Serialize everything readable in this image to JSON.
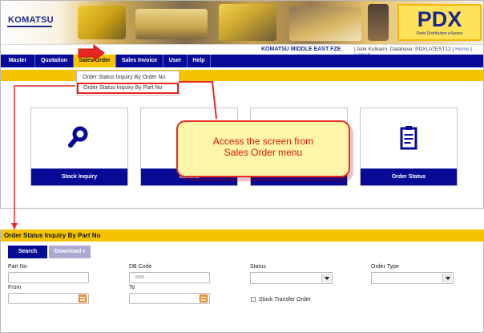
{
  "header": {
    "brand": "KOMATSU",
    "product": "PDX",
    "product_tagline": "Parts Distribution eXpress",
    "company": "KOMATSU MIDDLE EAST FZE",
    "user_info": "| Alok Kulkarni, Database: PDXLATEST12 |",
    "home_link": "Home",
    "logout_link": "Logout"
  },
  "nav": {
    "items": [
      {
        "label": "Master"
      },
      {
        "label": "Quotation"
      },
      {
        "label": "Sales Order"
      },
      {
        "label": "Sales Invoice"
      },
      {
        "label": "User"
      },
      {
        "label": "Help"
      }
    ],
    "active": "Sales Order"
  },
  "dropdown": {
    "items": [
      {
        "label": "Order Status Inquiry By Order No"
      },
      {
        "label": "Order Status Inquiry By Part No"
      }
    ],
    "highlighted": "Order Status Inquiry By Part No"
  },
  "dashboard": {
    "tiles": [
      {
        "label": "Stock Inquiry",
        "icon": "search-icon"
      },
      {
        "label": "Genera",
        "icon": "blank-icon"
      },
      {
        "label": "",
        "icon": "blank-icon"
      },
      {
        "label": "Order Status",
        "icon": "clipboard-icon"
      }
    ]
  },
  "callout": {
    "line1": "Access the screen from",
    "line2": "Sales Order menu"
  },
  "form": {
    "title": "Order Status Inquiry By Part No",
    "buttons": {
      "search": "Search",
      "download": "Download"
    },
    "fields": {
      "part_no": {
        "label": "Part No",
        "value": ""
      },
      "db_code": {
        "label": "DB Code",
        "value": "8206"
      },
      "status": {
        "label": "Status",
        "value": ""
      },
      "order_type": {
        "label": "Order Type",
        "value": ""
      },
      "from": {
        "label": "From",
        "value": ""
      },
      "to": {
        "label": "To",
        "value": ""
      },
      "stock_transfer_order": {
        "label": "Stock Transfer Order",
        "checked": false
      }
    }
  },
  "colors": {
    "navy": "#070a94",
    "yellow": "#f5c300",
    "accent_red": "#e92b25",
    "callout_fill": "#fff5a8"
  }
}
